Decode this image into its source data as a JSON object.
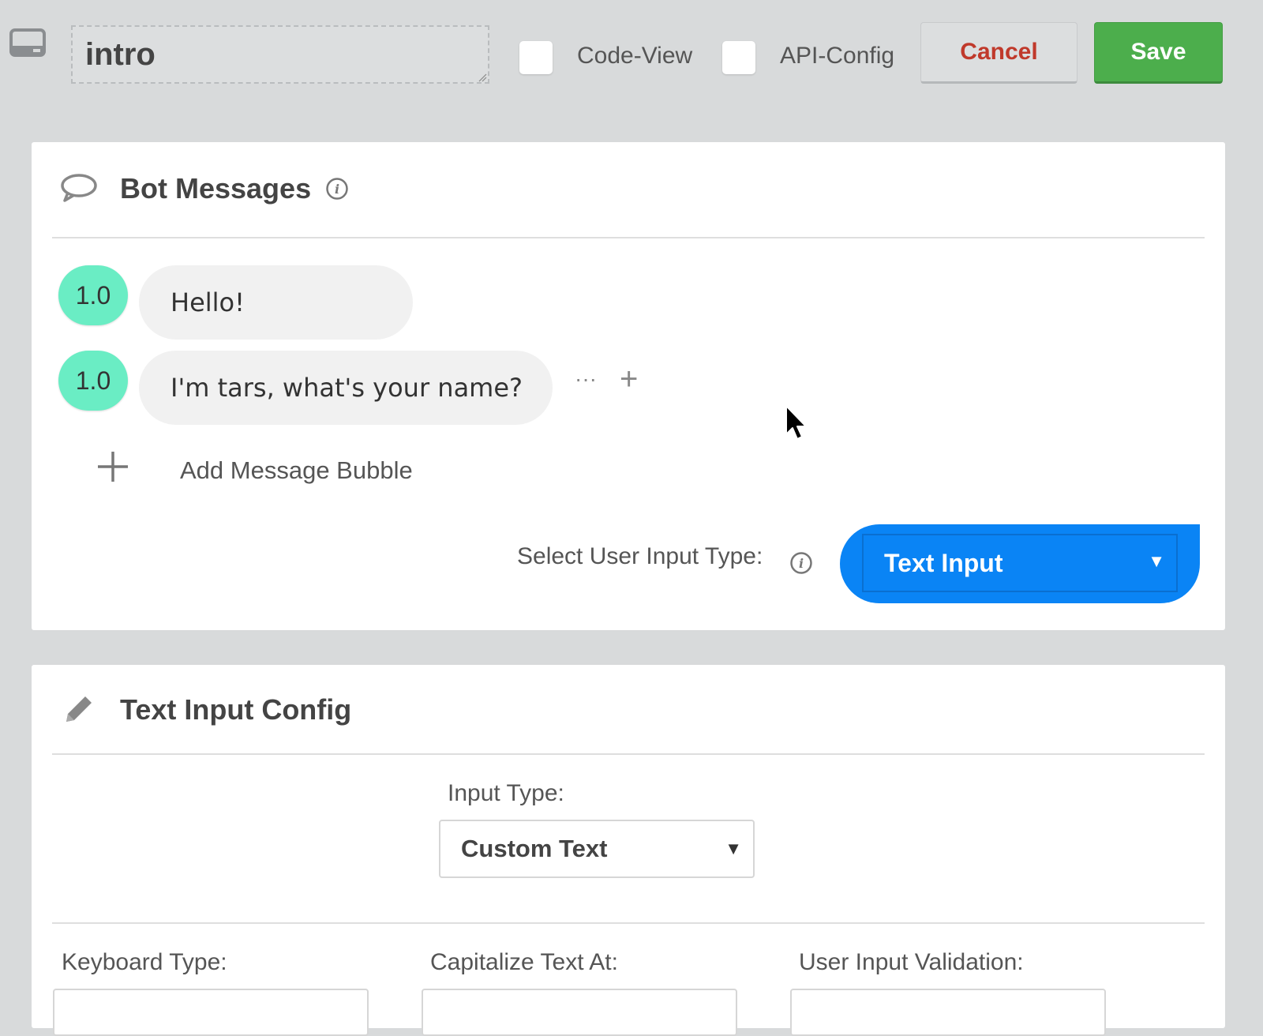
{
  "toolbar": {
    "name_value": "intro",
    "code_view_label": "Code-View",
    "api_config_label": "API-Config",
    "cancel_label": "Cancel",
    "save_label": "Save"
  },
  "bot_messages": {
    "title": "Bot Messages",
    "messages": [
      {
        "version": "1.0",
        "text": "Hello!"
      },
      {
        "version": "1.0",
        "text": "I'm tars, what's your name?"
      }
    ],
    "more_action": "···",
    "add_action": "+",
    "add_bubble_label": "Add Message Bubble",
    "input_type_label": "Select User Input Type:",
    "input_type_value": "Text Input",
    "caret": "▼"
  },
  "text_input_config": {
    "title": "Text Input Config",
    "input_type_label": "Input Type:",
    "input_type_value": "Custom Text",
    "keyboard_type_label": "Keyboard Type:",
    "capitalize_label": "Capitalize Text At:",
    "validation_label": "User Input Validation:",
    "caret": "▼"
  },
  "colors": {
    "accent_blue": "#0a84f5",
    "save_green": "#4cae4c",
    "cancel_red": "#c0392b",
    "badge_mint": "#6aedc4"
  },
  "icons": [
    "monitor-icon",
    "chat-bubble-icon",
    "info-icon",
    "pencil-icon",
    "plus-icon",
    "mouse-cursor-icon"
  ]
}
